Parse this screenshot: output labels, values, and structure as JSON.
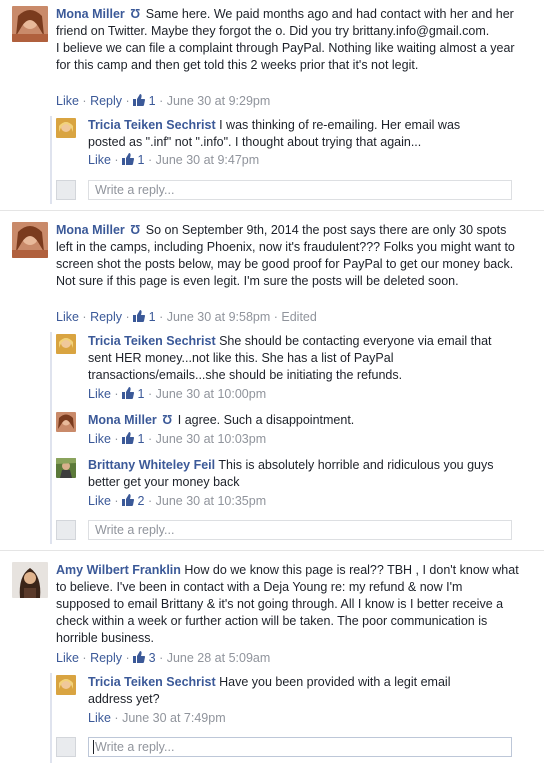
{
  "threads": [
    {
      "comment": {
        "name": "Mona Miller",
        "flag": "Ʊ",
        "text": "Same here. We paid months ago and had contact with her and her friend on Twitter. Maybe they forgot the o. Did you try brittany.info@gmail.com.",
        "text2": "I believe we can file a complaint through PayPal. Nothing like waiting almost a year for this camp and then get told this 2 weeks prior that it's not legit.",
        "like": "Like",
        "reply": "Reply",
        "likes": "1",
        "time": "June 30 at 9:29pm"
      },
      "replies": [
        {
          "name": "Tricia Teiken Sechrist",
          "text": "I was thinking of re-emailing. Her email was posted as \".inf\" not \".info\". I thought about trying that again...",
          "like": "Like",
          "likes": "1",
          "time": "June 30 at 9:47pm"
        }
      ],
      "reply_placeholder": "Write a reply..."
    },
    {
      "comment": {
        "name": "Mona Miller",
        "flag": "Ʊ",
        "text": "So on September 9th, 2014 the post says there are only 30 spots left in the camps, including Phoenix, now it's fraudulent??? Folks you might want to screen shot the posts below, may be good proof for PayPal to get our money back. Not sure if this page is even legit. I'm sure the posts will be deleted soon.",
        "like": "Like",
        "reply": "Reply",
        "likes": "1",
        "time": "June 30 at 9:58pm",
        "edited": "Edited"
      },
      "replies": [
        {
          "name": "Tricia Teiken Sechrist",
          "text": "She should be contacting everyone via email that sent HER money...not like this. She has a list of PayPal transactions/emails...she should be initiating the refunds.",
          "like": "Like",
          "likes": "1",
          "time": "June 30 at 10:00pm"
        },
        {
          "name": "Mona Miller",
          "flag": "Ʊ",
          "text": "I agree. Such a disappointment.",
          "like": "Like",
          "likes": "1",
          "time": "June 30 at 10:03pm"
        },
        {
          "name": "Brittany Whiteley Feil",
          "text": "This is absolutely horrible and ridiculous you guys better get your money back",
          "like": "Like",
          "likes": "2",
          "time": "June 30 at 10:35pm"
        }
      ],
      "reply_placeholder": "Write a reply..."
    },
    {
      "comment": {
        "name": "Amy Wilbert Franklin",
        "text": "How do we know this page is real?? TBH , I don't know what to believe. I've been in contact with a Deja Young re: my refund & now I'm supposed to email Brittany & it's not going through. All I know is I better receive a check within a week or further action will be taken. The poor communication is horrible business.",
        "like": "Like",
        "reply": "Reply",
        "likes": "3",
        "time": "June 28 at 5:09am"
      },
      "replies": [
        {
          "name": "Tricia Teiken Sechrist",
          "text": "Have you been provided with a legit email address yet?",
          "like": "Like",
          "time": "June 30 at 7:49pm"
        }
      ],
      "reply_placeholder": "Write a reply..."
    }
  ],
  "colors": {
    "link": "#3b5998",
    "meta": "#90949c",
    "text": "#1d2129"
  }
}
